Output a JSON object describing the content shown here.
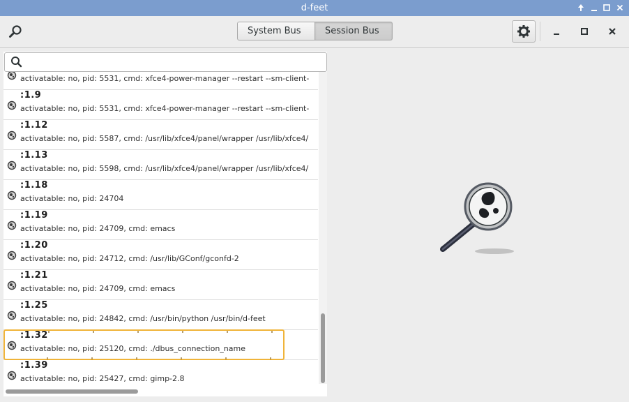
{
  "window": {
    "title": "d-feet",
    "controls": [
      "up-arrow",
      "minimize",
      "maximize",
      "close"
    ]
  },
  "header": {
    "bus_options": [
      "System Bus",
      "Session Bus"
    ],
    "selected_bus": "Session Bus",
    "settings_icon": "gear-icon",
    "search_icon": "search-icon"
  },
  "search": {
    "placeholder": "",
    "value": ""
  },
  "connections": [
    {
      "name": "",
      "desc": "activatable: no, pid: 5531, cmd: xfce4-power-manager --restart --sm-client-"
    },
    {
      "name": ":1.9",
      "desc": "activatable: no, pid: 5531, cmd: xfce4-power-manager --restart --sm-client-"
    },
    {
      "name": ":1.12",
      "desc": "activatable: no, pid: 5587, cmd: /usr/lib/xfce4/panel/wrapper /usr/lib/xfce4/"
    },
    {
      "name": ":1.13",
      "desc": "activatable: no, pid: 5598, cmd: /usr/lib/xfce4/panel/wrapper /usr/lib/xfce4/"
    },
    {
      "name": ":1.18",
      "desc": "activatable: no, pid: 24704"
    },
    {
      "name": ":1.19",
      "desc": "activatable: no, pid: 24709, cmd: emacs"
    },
    {
      "name": ":1.20",
      "desc": "activatable: no, pid: 24712, cmd: /usr/lib/GConf/gconfd-2"
    },
    {
      "name": ":1.21",
      "desc": "activatable: no, pid: 24709, cmd: emacs"
    },
    {
      "name": ":1.25",
      "desc": "activatable: no, pid: 24842, cmd: /usr/bin/python /usr/bin/d-feet"
    },
    {
      "name": ":1.32",
      "desc": "activatable: no, pid: 25120, cmd: ./dbus_connection_name",
      "selected": true
    },
    {
      "name": ":1.39",
      "desc": "activatable: no, pid: 25427, cmd: gimp-2.8"
    }
  ],
  "colors": {
    "titlebar": "#7b9dce",
    "selection_border": "#f0b43a"
  }
}
